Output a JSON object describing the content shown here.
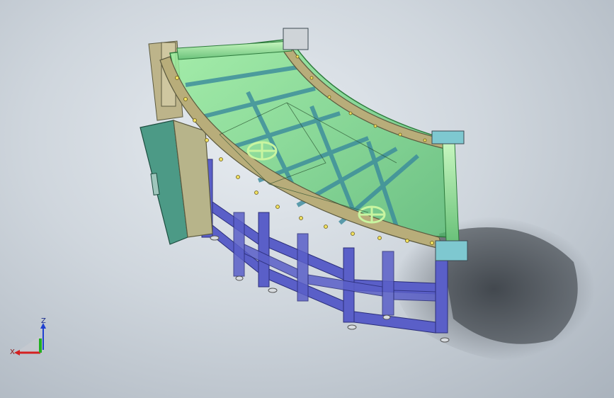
{
  "viewport": {
    "background_center": "#e6ebf0",
    "background_edge": "#aab3bd"
  },
  "model": {
    "frame_color": "#5a5fc8",
    "glass_color": "#7fe08a",
    "rail_color": "#b8ad7a",
    "cabinet_color": "#4c9a86"
  },
  "triad": {
    "x_label": "X",
    "z_label": "Z",
    "x_color": "#d42020",
    "y_color": "#20b020",
    "z_color": "#2040d0"
  }
}
